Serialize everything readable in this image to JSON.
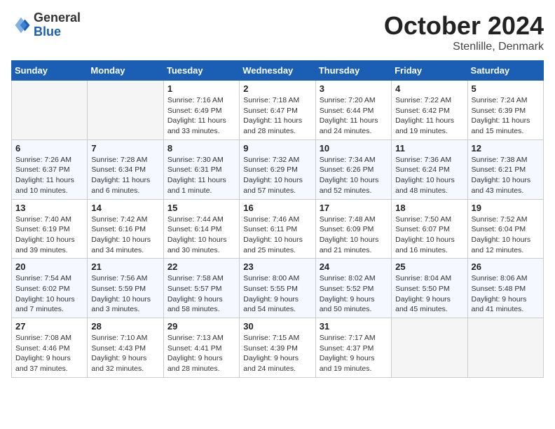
{
  "header": {
    "logo_line1": "General",
    "logo_line2": "Blue",
    "month_title": "October 2024",
    "location": "Stenlille, Denmark"
  },
  "weekdays": [
    "Sunday",
    "Monday",
    "Tuesday",
    "Wednesday",
    "Thursday",
    "Friday",
    "Saturday"
  ],
  "weeks": [
    [
      {
        "day": "",
        "info": ""
      },
      {
        "day": "",
        "info": ""
      },
      {
        "day": "1",
        "info": "Sunrise: 7:16 AM\nSunset: 6:49 PM\nDaylight: 11 hours\nand 33 minutes."
      },
      {
        "day": "2",
        "info": "Sunrise: 7:18 AM\nSunset: 6:47 PM\nDaylight: 11 hours\nand 28 minutes."
      },
      {
        "day": "3",
        "info": "Sunrise: 7:20 AM\nSunset: 6:44 PM\nDaylight: 11 hours\nand 24 minutes."
      },
      {
        "day": "4",
        "info": "Sunrise: 7:22 AM\nSunset: 6:42 PM\nDaylight: 11 hours\nand 19 minutes."
      },
      {
        "day": "5",
        "info": "Sunrise: 7:24 AM\nSunset: 6:39 PM\nDaylight: 11 hours\nand 15 minutes."
      }
    ],
    [
      {
        "day": "6",
        "info": "Sunrise: 7:26 AM\nSunset: 6:37 PM\nDaylight: 11 hours\nand 10 minutes."
      },
      {
        "day": "7",
        "info": "Sunrise: 7:28 AM\nSunset: 6:34 PM\nDaylight: 11 hours\nand 6 minutes."
      },
      {
        "day": "8",
        "info": "Sunrise: 7:30 AM\nSunset: 6:31 PM\nDaylight: 11 hours\nand 1 minute."
      },
      {
        "day": "9",
        "info": "Sunrise: 7:32 AM\nSunset: 6:29 PM\nDaylight: 10 hours\nand 57 minutes."
      },
      {
        "day": "10",
        "info": "Sunrise: 7:34 AM\nSunset: 6:26 PM\nDaylight: 10 hours\nand 52 minutes."
      },
      {
        "day": "11",
        "info": "Sunrise: 7:36 AM\nSunset: 6:24 PM\nDaylight: 10 hours\nand 48 minutes."
      },
      {
        "day": "12",
        "info": "Sunrise: 7:38 AM\nSunset: 6:21 PM\nDaylight: 10 hours\nand 43 minutes."
      }
    ],
    [
      {
        "day": "13",
        "info": "Sunrise: 7:40 AM\nSunset: 6:19 PM\nDaylight: 10 hours\nand 39 minutes."
      },
      {
        "day": "14",
        "info": "Sunrise: 7:42 AM\nSunset: 6:16 PM\nDaylight: 10 hours\nand 34 minutes."
      },
      {
        "day": "15",
        "info": "Sunrise: 7:44 AM\nSunset: 6:14 PM\nDaylight: 10 hours\nand 30 minutes."
      },
      {
        "day": "16",
        "info": "Sunrise: 7:46 AM\nSunset: 6:11 PM\nDaylight: 10 hours\nand 25 minutes."
      },
      {
        "day": "17",
        "info": "Sunrise: 7:48 AM\nSunset: 6:09 PM\nDaylight: 10 hours\nand 21 minutes."
      },
      {
        "day": "18",
        "info": "Sunrise: 7:50 AM\nSunset: 6:07 PM\nDaylight: 10 hours\nand 16 minutes."
      },
      {
        "day": "19",
        "info": "Sunrise: 7:52 AM\nSunset: 6:04 PM\nDaylight: 10 hours\nand 12 minutes."
      }
    ],
    [
      {
        "day": "20",
        "info": "Sunrise: 7:54 AM\nSunset: 6:02 PM\nDaylight: 10 hours\nand 7 minutes."
      },
      {
        "day": "21",
        "info": "Sunrise: 7:56 AM\nSunset: 5:59 PM\nDaylight: 10 hours\nand 3 minutes."
      },
      {
        "day": "22",
        "info": "Sunrise: 7:58 AM\nSunset: 5:57 PM\nDaylight: 9 hours\nand 58 minutes."
      },
      {
        "day": "23",
        "info": "Sunrise: 8:00 AM\nSunset: 5:55 PM\nDaylight: 9 hours\nand 54 minutes."
      },
      {
        "day": "24",
        "info": "Sunrise: 8:02 AM\nSunset: 5:52 PM\nDaylight: 9 hours\nand 50 minutes."
      },
      {
        "day": "25",
        "info": "Sunrise: 8:04 AM\nSunset: 5:50 PM\nDaylight: 9 hours\nand 45 minutes."
      },
      {
        "day": "26",
        "info": "Sunrise: 8:06 AM\nSunset: 5:48 PM\nDaylight: 9 hours\nand 41 minutes."
      }
    ],
    [
      {
        "day": "27",
        "info": "Sunrise: 7:08 AM\nSunset: 4:46 PM\nDaylight: 9 hours\nand 37 minutes."
      },
      {
        "day": "28",
        "info": "Sunrise: 7:10 AM\nSunset: 4:43 PM\nDaylight: 9 hours\nand 32 minutes."
      },
      {
        "day": "29",
        "info": "Sunrise: 7:13 AM\nSunset: 4:41 PM\nDaylight: 9 hours\nand 28 minutes."
      },
      {
        "day": "30",
        "info": "Sunrise: 7:15 AM\nSunset: 4:39 PM\nDaylight: 9 hours\nand 24 minutes."
      },
      {
        "day": "31",
        "info": "Sunrise: 7:17 AM\nSunset: 4:37 PM\nDaylight: 9 hours\nand 19 minutes."
      },
      {
        "day": "",
        "info": ""
      },
      {
        "day": "",
        "info": ""
      }
    ]
  ]
}
